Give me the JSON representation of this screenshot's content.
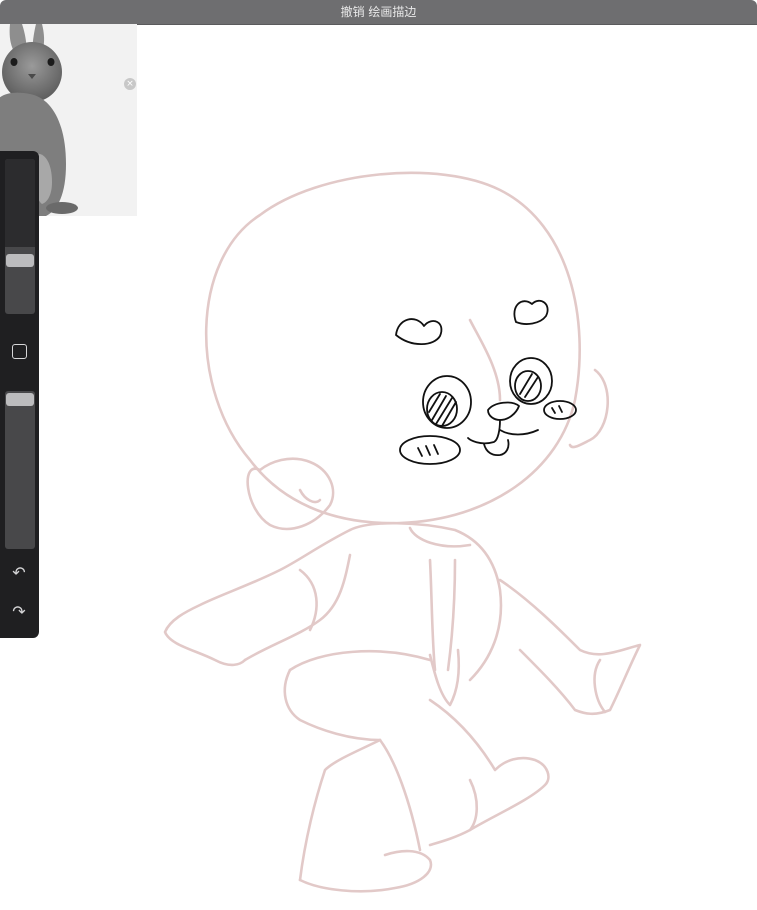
{
  "topbar": {
    "title": "撤销 绘画描边"
  },
  "reference": {
    "close_label": "×"
  },
  "sidebar": {
    "brush_size": {
      "value": 0.29
    },
    "opacity": {
      "value": 0.06
    },
    "undo_icon": "undo-arrow-icon",
    "redo_icon": "redo-arrow-icon",
    "modify_icon": "square-modify-icon"
  },
  "colors": {
    "sketch": "#e2c9c8",
    "ink": "#111111",
    "toolbar": "#1f1f21"
  }
}
